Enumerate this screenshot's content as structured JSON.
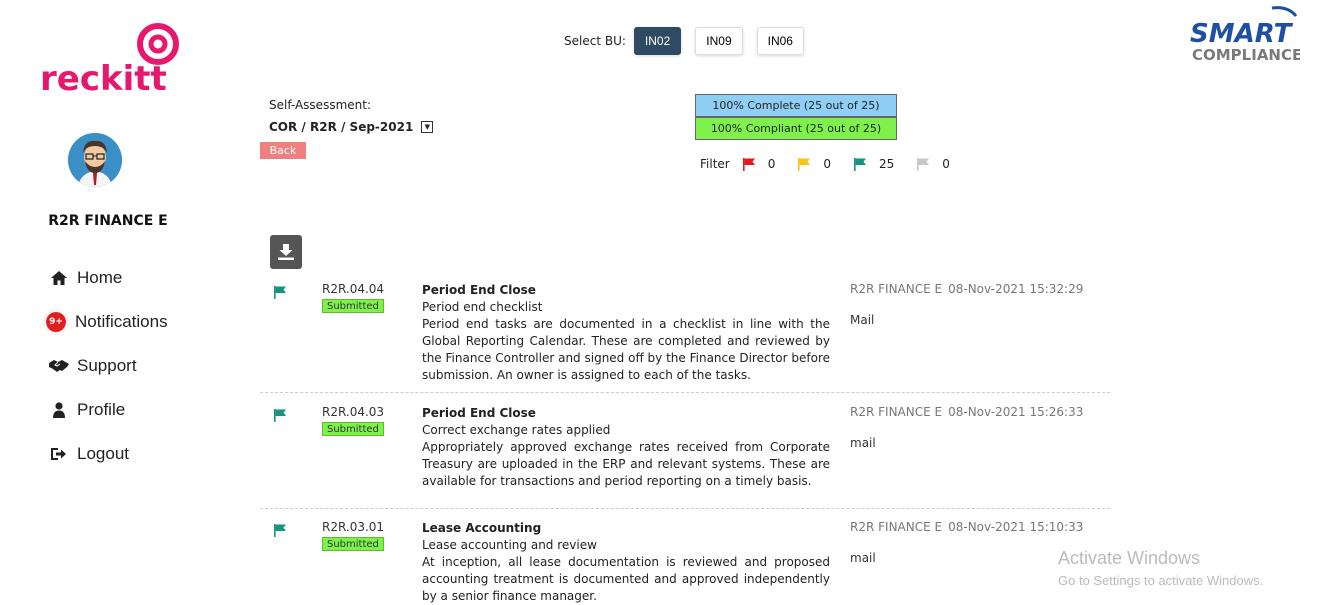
{
  "brand": {
    "logo_text": "reckitt",
    "partner_logo_line1": "SMART",
    "partner_logo_line2": "COMPLIANCE"
  },
  "user": {
    "name": "R2R FINANCE E"
  },
  "nav": [
    {
      "label": "Home",
      "icon": "home-icon"
    },
    {
      "label": "Notifications",
      "icon": "notification-badge",
      "badge": "9+"
    },
    {
      "label": "Support",
      "icon": "handshake-icon"
    },
    {
      "label": "Profile",
      "icon": "user-icon"
    },
    {
      "label": "Logout",
      "icon": "logout-icon"
    }
  ],
  "bu": {
    "label": "Select BU:",
    "options": [
      "IN02",
      "IN09",
      "IN06"
    ],
    "selected": "IN02"
  },
  "assessment": {
    "label": "Self-Assessment:",
    "value": "COR / R2R / Sep-2021",
    "back_label": "Back"
  },
  "status": {
    "complete": "100% Complete (25 out of 25)",
    "compliant": "100% Compliant (25 out of 25)"
  },
  "filter": {
    "label": "Filter",
    "flags": [
      {
        "color": "#e81818",
        "count": "0"
      },
      {
        "color": "#f5c518",
        "count": "0"
      },
      {
        "color": "#16947e",
        "count": "25"
      },
      {
        "color": "#c8c8c8",
        "count": "0"
      }
    ]
  },
  "records": [
    {
      "code": "R2R.04.04",
      "status": "Submitted",
      "title": "Period End Close",
      "subtitle": "Period end checklist",
      "description": "Period end tasks are documented in a checklist in line with the Global Reporting Calendar. These are completed and reviewed by the Finance Controller and signed off by the Finance Director before submission. An owner is assigned to each of the tasks.",
      "user": "R2R FINANCE E",
      "timestamp": "08-Nov-2021 15:32:29",
      "comment": "Mail"
    },
    {
      "code": "R2R.04.03",
      "status": "Submitted",
      "title": "Period End Close",
      "subtitle": "Correct exchange rates applied",
      "description": "Appropriately approved exchange rates received from Corporate Treasury are uploaded in the ERP and relevant systems. These are available for transactions and period reporting on a timely basis.",
      "user": "R2R FINANCE E",
      "timestamp": "08-Nov-2021 15:26:33",
      "comment": "mail"
    },
    {
      "code": "R2R.03.01",
      "status": "Submitted",
      "title": "Lease Accounting",
      "subtitle": "Lease accounting and review",
      "description": "At inception, all lease documentation is reviewed and proposed accounting treatment is documented and approved independently by a senior finance manager.",
      "user": "R2R FINANCE E",
      "timestamp": "08-Nov-2021 15:10:33",
      "comment": "mail"
    }
  ],
  "watermark": {
    "title": "Activate Windows",
    "subtitle": "Go to Settings to activate Windows."
  },
  "colors": {
    "accent_pink": "#e5186e",
    "bu_active": "#2f4a63",
    "flag_green": "#16947e",
    "submitted_green": "#7ef24a",
    "complete_blue": "#8fcff5"
  }
}
